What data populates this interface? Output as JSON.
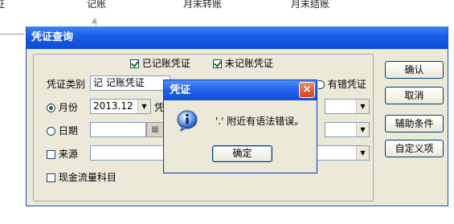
{
  "background": {
    "nav_items": [
      "证",
      "记账",
      "月末转账",
      "月末结账"
    ]
  },
  "dialog": {
    "title": "凭证查询",
    "filters": {
      "recorded_label": "已记账凭证",
      "recorded_checked": true,
      "unrecorded_label": "未记账凭证",
      "unrecorded_checked": true,
      "error_label": "有错凭证"
    },
    "voucher_type": {
      "label": "凭证类别",
      "value": "记 记账凭证"
    },
    "month": {
      "label": "月份",
      "value": "2013.12",
      "selected": true,
      "next_label_partial": "凭"
    },
    "date": {
      "label": "日期",
      "selected": false,
      "value": ""
    },
    "source": {
      "label": "来源",
      "checked": false,
      "value": ""
    },
    "cash_flow": {
      "label": "现金流量科目",
      "checked": false
    },
    "buttons": {
      "confirm": "确认",
      "cancel": "取消",
      "aux_condition": "辅助条件",
      "custom_item": "自定义项"
    }
  },
  "modal": {
    "title": "凭证",
    "icon": "info-icon",
    "message": "'.' 附近有语法错误。",
    "ok_label": "确定",
    "close_label": "×"
  },
  "colors": {
    "titlebar": "#0a4bd6",
    "dialog_bg": "#ece9d8",
    "close_btn": "#d4441c",
    "check_mark": "#1f6d0f"
  }
}
